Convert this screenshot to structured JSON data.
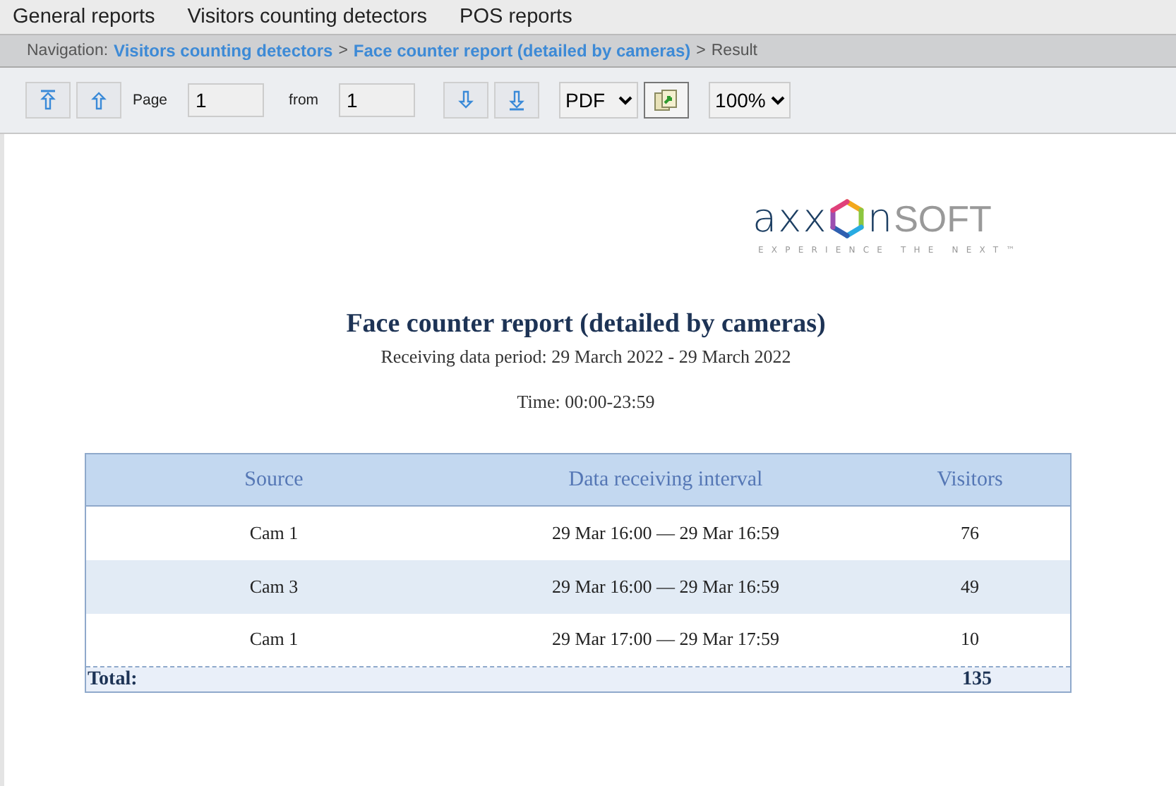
{
  "menu": [
    {
      "label": "General reports",
      "selected": false
    },
    {
      "label": "Visitors counting detectors",
      "selected": false
    },
    {
      "label": "POS reports",
      "selected": false
    }
  ],
  "navigation": {
    "label": "Navigation:",
    "links": [
      "Visitors counting detectors",
      "Face counter report (detailed by cameras)"
    ],
    "separator": ">",
    "current": "Result"
  },
  "toolbar": {
    "page_label": "Page",
    "page": "1",
    "from_label": "from",
    "total": "1",
    "format": "PDF",
    "zoom": "100%"
  },
  "report": {
    "logo": {
      "left": "axx",
      "right": "n",
      "light": "SOFT",
      "tagline": "EXPERIENCE THE NEXT",
      "mark": "™"
    },
    "title": "Face counter report (detailed by cameras)",
    "period": "Receiving data period: 29 March 2022 - 29 March 2022",
    "time": "Time: 00:00-23:59",
    "table": {
      "columns": [
        "Source",
        "Data receiving interval",
        "Visitors"
      ],
      "rows": [
        [
          "Cam 1",
          "29 Mar 16:00 — 29 Mar 16:59",
          "76"
        ],
        [
          "Cam 3",
          "29 Mar 16:00 — 29 Mar 16:59",
          "49"
        ],
        [
          "Cam 1",
          "29 Mar 17:00 — 29 Mar 17:59",
          "10"
        ]
      ],
      "total_label": "Total:",
      "total": "135"
    }
  }
}
